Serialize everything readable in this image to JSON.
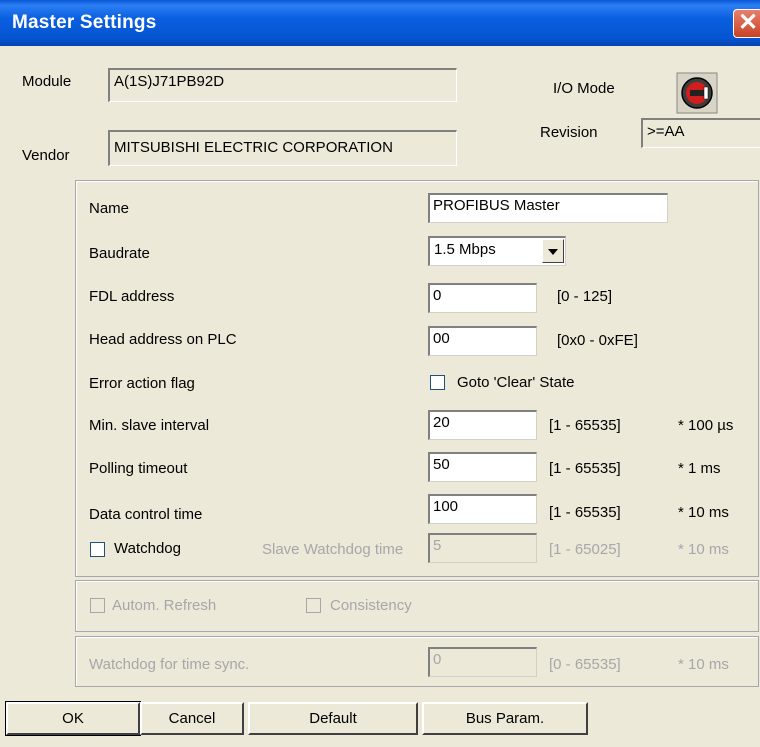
{
  "window": {
    "title": "Master Settings",
    "close_glyph": "✕"
  },
  "module": {
    "label": "Module",
    "value": "A(1S)J71PB92D"
  },
  "vendor": {
    "label": "Vendor",
    "value": "MITSUBISHI ELECTRIC CORPORATION"
  },
  "io_mode": {
    "label": "I/O Mode",
    "icon": "rotary-switch-icon"
  },
  "revision": {
    "label": "Revision",
    "value": ">=AA"
  },
  "params": {
    "name": {
      "label": "Name",
      "value": "PROFIBUS Master"
    },
    "baudrate": {
      "label": "Baudrate",
      "value": "1.5 Mbps"
    },
    "fdl": {
      "label": "FDL address",
      "value": "0",
      "range": "[0 - 125]"
    },
    "head": {
      "label": "Head address on PLC",
      "value": "00",
      "range": "[0x0 - 0xFE]"
    },
    "error_flag": {
      "label": "Error action flag",
      "checkbox_label": "Goto 'Clear' State",
      "checked": false
    },
    "min_slave": {
      "label": "Min. slave interval",
      "value": "20",
      "range": "[1 - 65535]",
      "unit": "* 100 µs"
    },
    "polling": {
      "label": "Polling timeout",
      "value": "50",
      "range": "[1 - 65535]",
      "unit": "* 1 ms"
    },
    "data_ctrl": {
      "label": "Data control time",
      "value": "100",
      "range": "[1 - 65535]",
      "unit": "* 10 ms"
    },
    "watchdog": {
      "label": "Watchdog",
      "checked": false,
      "slave_label": "Slave Watchdog time",
      "value": "5",
      "range": "[1 - 65025]",
      "unit": "* 10 ms"
    }
  },
  "refresh": {
    "autom_refresh": {
      "label": "Autom. Refresh",
      "checked": false
    },
    "consistency": {
      "label": "Consistency",
      "checked": false
    }
  },
  "time_sync": {
    "label": "Watchdog for time sync.",
    "value": "0",
    "range": "[0 - 65535]",
    "unit": "* 10 ms"
  },
  "buttons": {
    "ok": "OK",
    "cancel": "Cancel",
    "default": "Default",
    "bus_param": "Bus Param."
  },
  "colors": {
    "titlebar": "#0a5fe0",
    "dialog_bg": "#ece9d8",
    "close": "#c94128",
    "disabled_text": "#a7a6aa"
  }
}
